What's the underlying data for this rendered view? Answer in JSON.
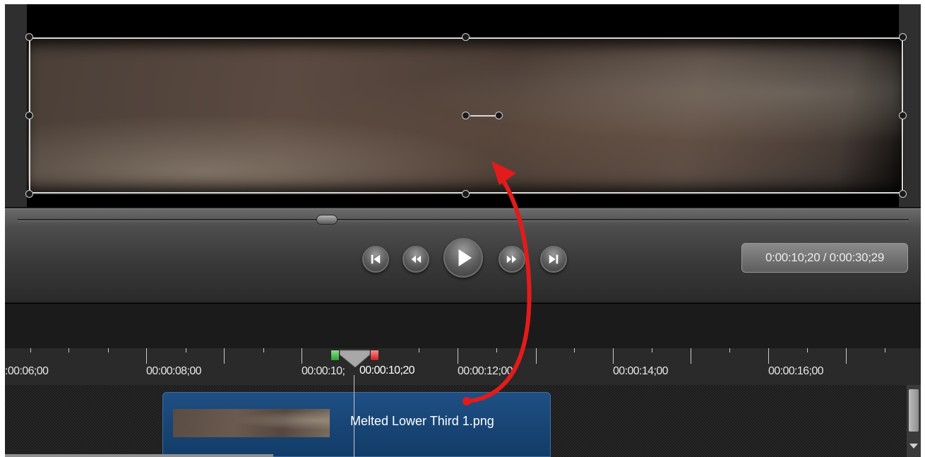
{
  "preview": {
    "media_description": "blurred brown lower-third image"
  },
  "playback": {
    "time_display": "0:00:10;20 / 0:00:30;29",
    "buttons": [
      "skip-to-start",
      "rewind",
      "play",
      "fast-forward",
      "skip-to-end"
    ],
    "scrub_position_fraction": 0.35
  },
  "timeline": {
    "ruler_labels": [
      ":00:06;00",
      "00:00:08;00",
      "00:00:10;",
      "00:00:12;00",
      "00:00:14;00",
      "00:00:16;00"
    ],
    "playhead_time": "00:00:10;20"
  },
  "track": {
    "clip_name": "Melted Lower Third 1.png"
  },
  "colors": {
    "clip_fill": "#1f4f84",
    "annotation_arrow": "#e31b1b",
    "in_marker": "#2fa12f",
    "out_marker": "#c82020"
  }
}
